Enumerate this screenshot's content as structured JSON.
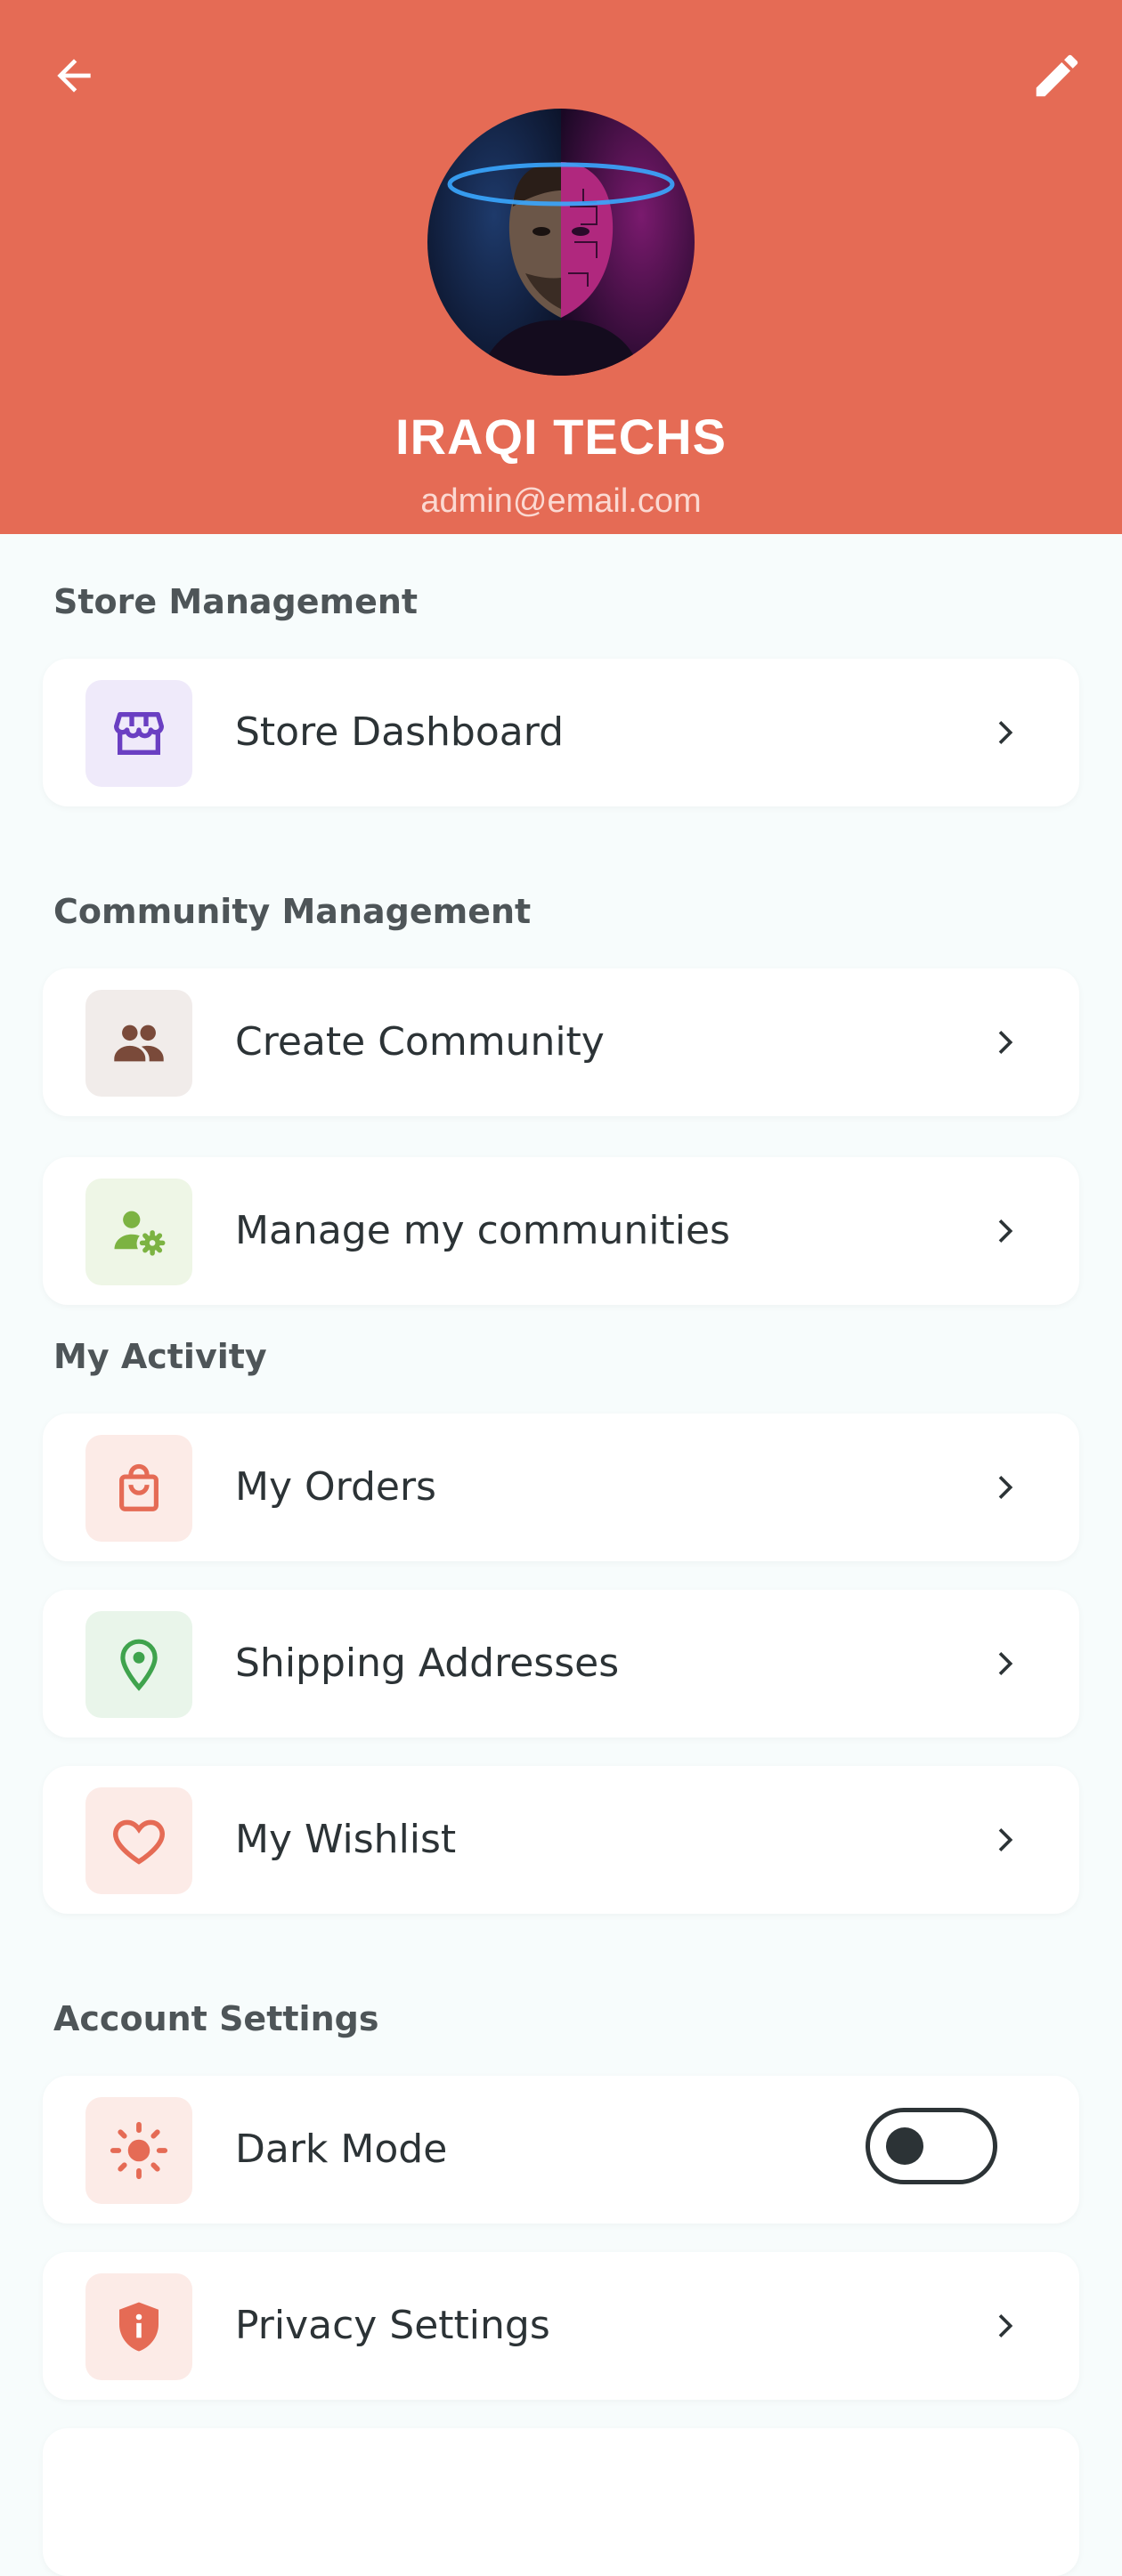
{
  "header": {
    "name": "IRAQI TECHS",
    "email": "admin@email.com",
    "background": "#E56B55"
  },
  "sections": {
    "store": "Store Management",
    "community": "Community Management",
    "activity": "My Activity",
    "account": "Account Settings"
  },
  "items": [
    {
      "label": "Store Dashboard",
      "icon": "store-icon"
    },
    {
      "label": "Create Community",
      "icon": "group-icon"
    },
    {
      "label": "Manage my communities",
      "icon": "user-settings-icon"
    },
    {
      "label": "My Orders",
      "icon": "shopping-bag-icon"
    },
    {
      "label": "Shipping Addresses",
      "icon": "location-pin-icon"
    },
    {
      "label": "My Wishlist",
      "icon": "heart-icon"
    },
    {
      "label": "Dark Mode",
      "icon": "sun-icon",
      "toggle_on": false
    },
    {
      "label": "Privacy Settings",
      "icon": "shield-icon"
    }
  ]
}
